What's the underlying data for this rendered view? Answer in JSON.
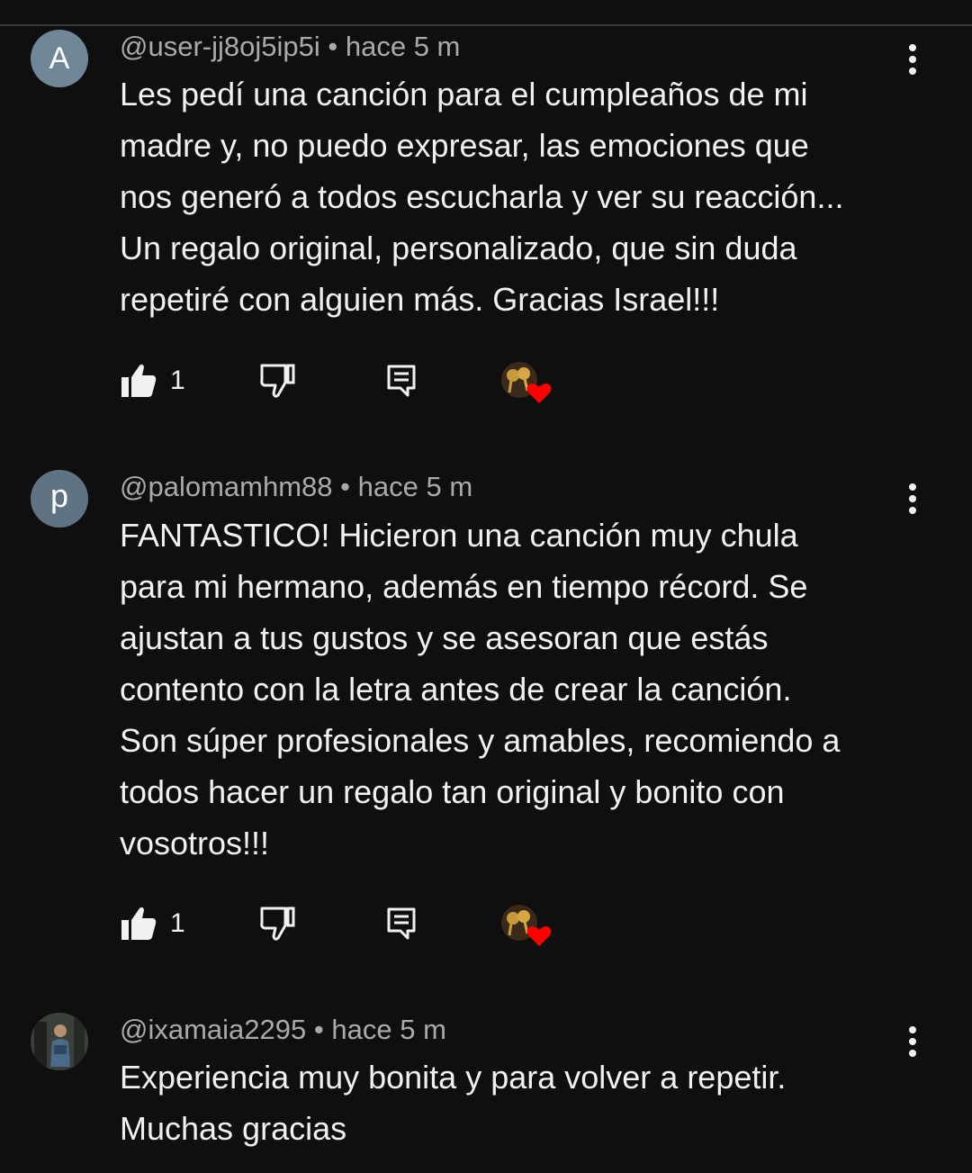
{
  "comments": [
    {
      "avatar_letter": "A",
      "handle": "@user-jj8oj5ip5i",
      "separator": "•",
      "time": "hace 5 m",
      "text": "Les pedí una canción para el cumpleaños de mi\nmadre y, no puedo expresar, las emociones que\nnos generó a todos escucharla y ver su reacción...\nUn regalo original, personalizado, que sin duda\nrepetiré con alguien más. Gracias Israel!!!",
      "likes": "1"
    },
    {
      "avatar_letter": "p",
      "handle": "@palomamhm88",
      "separator": "•",
      "time": "hace 5 m",
      "text": "FANTASTICO! Hicieron una canción muy chula\npara mi hermano, además en tiempo récord. Se\najustan a tus gustos y se asesoran que estás\ncontento con la letra antes de crear la canción.\nSon súper profesionales y amables, recomiendo a\ntodos hacer un regalo tan original y bonito con\nvosotros!!!",
      "likes": "1"
    },
    {
      "avatar_letter": "",
      "handle": "@ixamaia2295",
      "separator": "•",
      "time": "hace 5 m",
      "text": "Experiencia muy bonita y para volver a repetir.\nMuchas gracias",
      "likes": ""
    }
  ],
  "icons": {
    "like": "thumb-up-icon",
    "dislike": "thumb-down-icon",
    "reply": "reply-comment-icon",
    "creator_heart": "creator-heart-icon",
    "more": "more-vertical-icon"
  },
  "colors": {
    "background": "#0f0f0f",
    "text": "#f1f1f1",
    "meta": "#aaaaaa",
    "heart": "#ff0000"
  }
}
